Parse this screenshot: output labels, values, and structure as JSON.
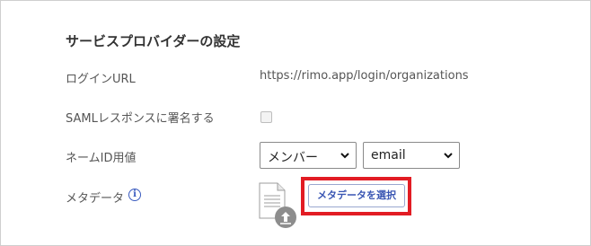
{
  "section": {
    "title": "サービスプロバイダーの設定"
  },
  "fields": {
    "login_url": {
      "label": "ログインURL",
      "value": "https://rimo.app/login/organizations"
    },
    "saml_sign": {
      "label": "SAMLレスポンスに署名する",
      "checked": false
    },
    "name_id": {
      "label": "ネームID用値",
      "select1_value": "メンバー",
      "select2_value": "email"
    },
    "metadata": {
      "label": "メタデータ",
      "info_icon": "ⓘ",
      "button_label": "メタデータを選択"
    }
  },
  "colors": {
    "highlight": "#e21c24",
    "accent": "#3a56b3"
  }
}
